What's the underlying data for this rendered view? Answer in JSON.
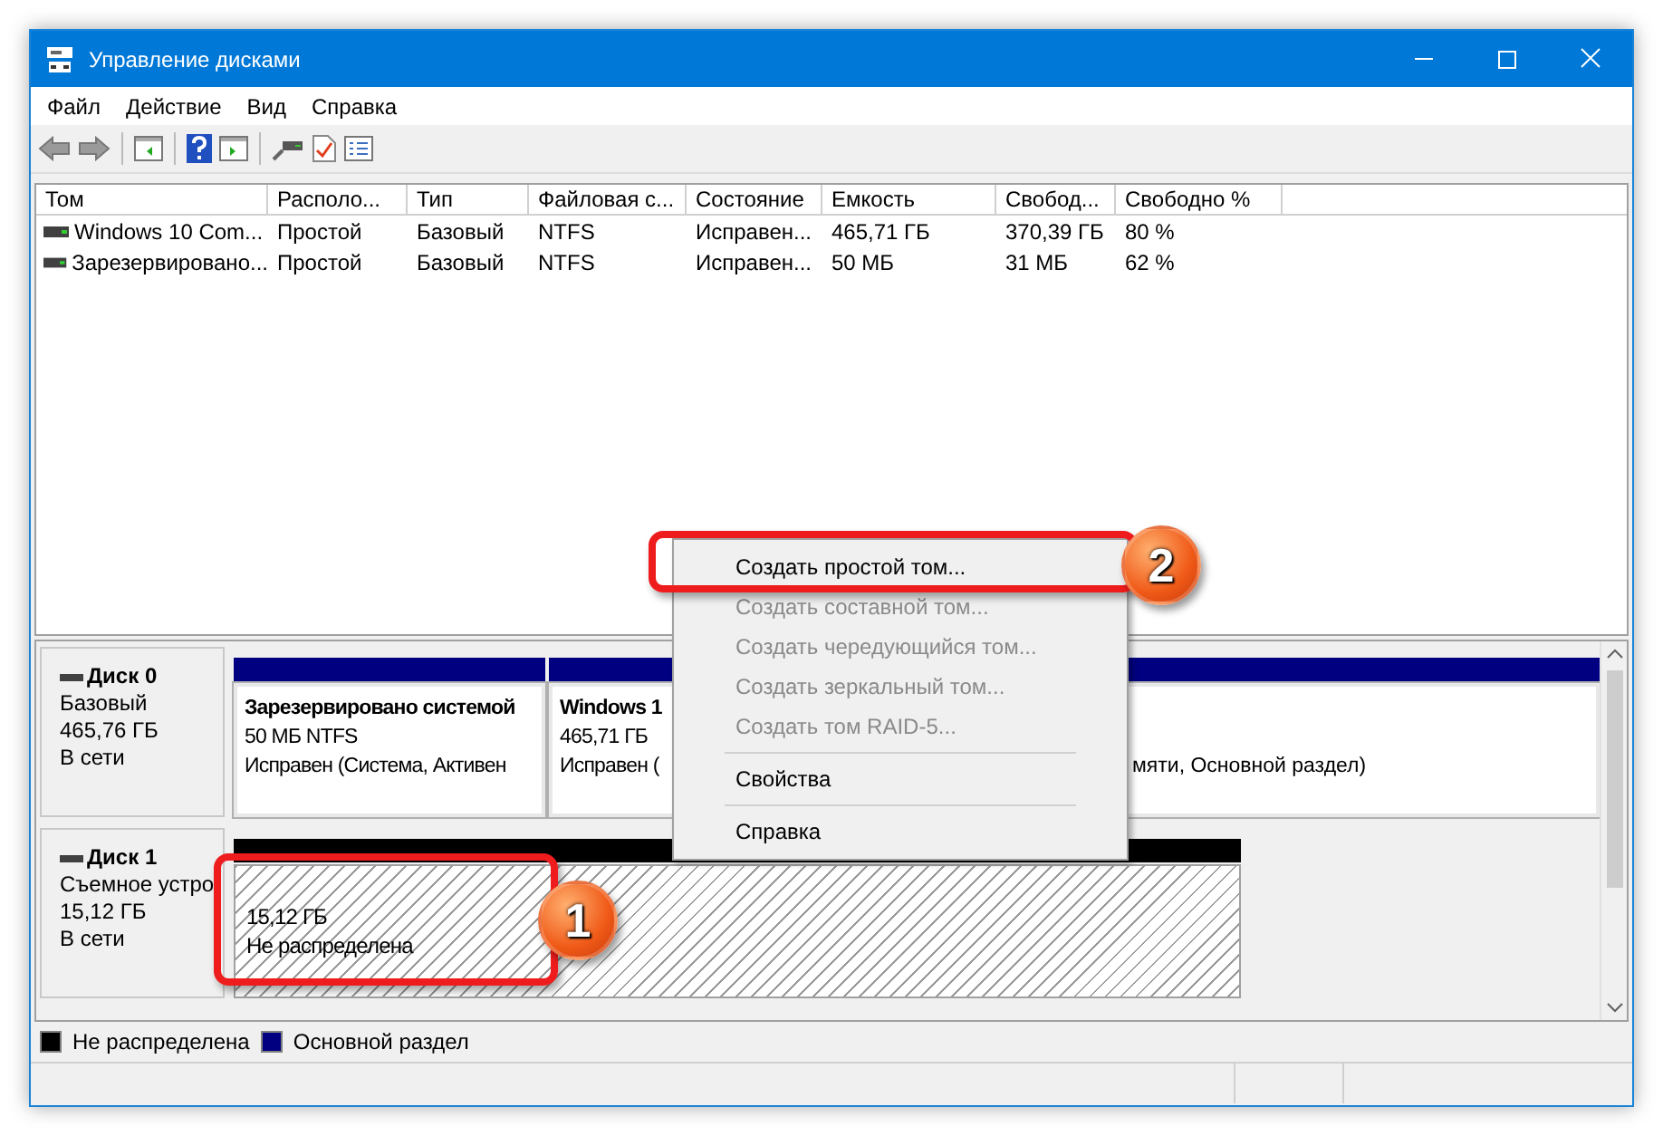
{
  "window": {
    "title": "Управление дисками"
  },
  "menu": [
    "Файл",
    "Действие",
    "Вид",
    "Справка"
  ],
  "volumes": {
    "columns": [
      "Том",
      "Располо...",
      "Тип",
      "Файловая с...",
      "Состояние",
      "Емкость",
      "Свобод...",
      "Свободно %"
    ],
    "rows": [
      [
        "Windows 10 Com...",
        "Простой",
        "Базовый",
        "NTFS",
        "Исправен...",
        "465,71 ГБ",
        "370,39 ГБ",
        "80 %"
      ],
      [
        "Зарезервировано...",
        "Простой",
        "Базовый",
        "NTFS",
        "Исправен...",
        "50 МБ",
        "31 МБ",
        "62 %"
      ]
    ]
  },
  "disks": [
    {
      "name": "Диск 0",
      "lines": [
        "Базовый",
        "465,76 ГБ",
        "В сети"
      ],
      "partitions": [
        {
          "kind": "primary",
          "color": "#000080",
          "lines": [
            {
              "left": "Зарезервировано системой"
            },
            {
              "left": "50 МБ NTFS"
            },
            {
              "left": "Исправен (Система, Активен"
            }
          ]
        },
        {
          "kind": "primary",
          "color": "#000080",
          "lines": [
            {
              "left": "Windows 1"
            },
            {
              "left": "465,71 ГБ"
            },
            {
              "left": "Исправен (",
              "right": "мяти, Основной раздел)"
            }
          ]
        }
      ]
    },
    {
      "name": "Диск 1",
      "lines": [
        "Съемное устро",
        "15,12 ГБ",
        "В сети"
      ],
      "partitions": [
        {
          "kind": "unallocated",
          "color": "#000000",
          "lines": [
            {
              "left": "15,12 ГБ"
            },
            {
              "left": "Не распределена"
            }
          ]
        }
      ]
    }
  ],
  "legend": [
    {
      "label": "Не распределена",
      "color": "#000000"
    },
    {
      "label": "Основной раздел",
      "color": "#000080"
    }
  ],
  "context_menu": [
    {
      "kind": "item",
      "label": "Создать простой том...",
      "disabled": false
    },
    {
      "kind": "item",
      "label": "Создать составной том...",
      "disabled": true
    },
    {
      "kind": "item",
      "label": "Создать чередующийся том...",
      "disabled": true
    },
    {
      "kind": "item",
      "label": "Создать зеркальный том...",
      "disabled": true
    },
    {
      "kind": "item",
      "label": "Создать том RAID-5...",
      "disabled": true
    },
    {
      "kind": "separator"
    },
    {
      "kind": "item",
      "label": "Свойства",
      "disabled": false
    },
    {
      "kind": "separator"
    },
    {
      "kind": "item",
      "label": "Справка",
      "disabled": false
    }
  ],
  "annotations": [
    {
      "number": "1"
    },
    {
      "number": "2"
    }
  ]
}
